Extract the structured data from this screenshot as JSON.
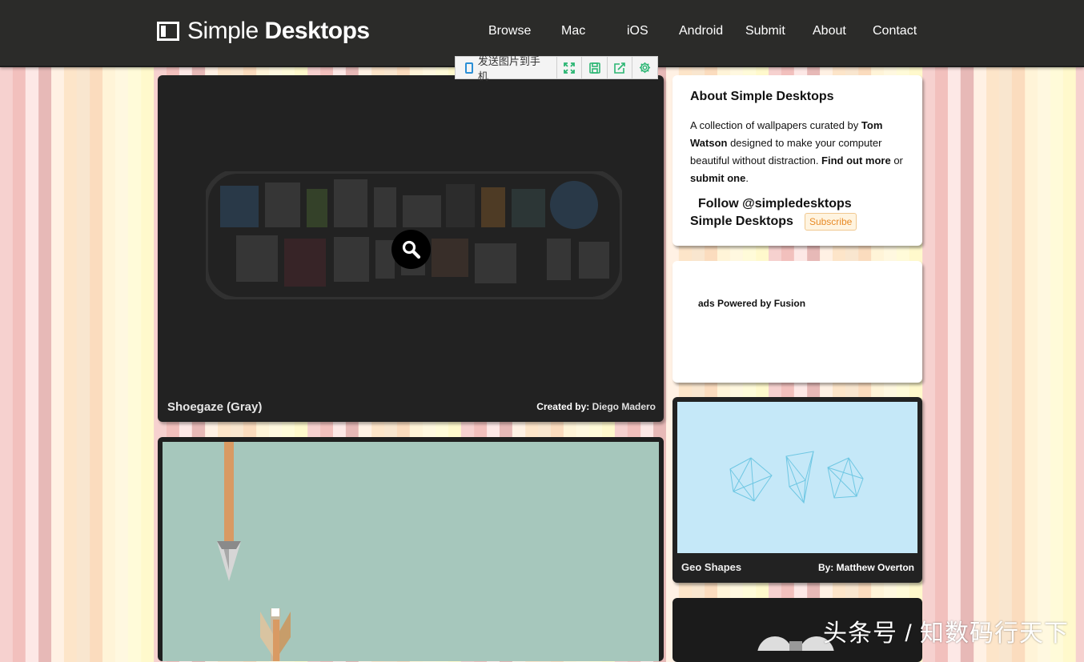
{
  "header": {
    "logo_light": "Simple",
    "logo_bold": "Desktops",
    "nav": [
      "Browse",
      "Mac",
      "iOS",
      "Android",
      "Submit",
      "About",
      "Contact"
    ]
  },
  "extension": {
    "send_label": "发送图片到手机",
    "buttons": [
      "expand-icon",
      "save-icon",
      "share-icon",
      "settings-icon"
    ]
  },
  "featured": {
    "title": "Shoegaze (Gray)",
    "credit_prefix": "Created by:",
    "author": "Diego Madero"
  },
  "sidebar": {
    "about_title": "About Simple Desktops",
    "about_text": {
      "p1": "A collection of wallpapers curated by ",
      "author": "Tom Watson",
      "p2": " designed to make your computer beautiful without distraction. ",
      "find_out": "Find out more",
      "p3": " or ",
      "submit": "submit one",
      "p4": "."
    },
    "follow": "Follow @simpledesktops",
    "site_name": "Simple Desktops",
    "subscribe": "Subscribe",
    "ads": "ads Powered by Fusion"
  },
  "geo_card": {
    "title": "Geo Shapes",
    "credit_prefix": "By:",
    "author": "Matthew Overton"
  },
  "watermark": "头条号 / 知数码行天下",
  "colors": {
    "header_bg": "#2b2b29",
    "card_bg": "#222222",
    "second_wallpaper_bg": "#a6c7bc",
    "geo_bg": "#c5e8f8",
    "subscribe_orange": "#e88b27",
    "extension_green": "#2bb673"
  }
}
